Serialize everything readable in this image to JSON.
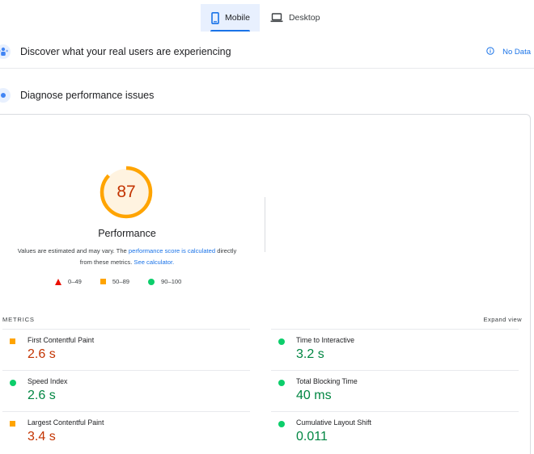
{
  "device_tabs": [
    {
      "label": "Mobile",
      "active": true
    },
    {
      "label": "Desktop",
      "active": false
    }
  ],
  "field_section": {
    "title": "Discover what your real users are experiencing",
    "no_data_label": "No Data"
  },
  "lab_section": {
    "title": "Diagnose performance issues"
  },
  "performance": {
    "score": "87",
    "score_fraction": 0.87,
    "title": "Performance",
    "desc_prefix": "Values are estimated and may vary. The ",
    "desc_link1": "performance score is calculated",
    "desc_middle": " directly from these metrics. ",
    "desc_link2": "See calculator."
  },
  "legend": [
    {
      "shape": "triangle",
      "label": "0–49"
    },
    {
      "shape": "square",
      "label": "50–89"
    },
    {
      "shape": "circle",
      "label": "90–100"
    }
  ],
  "metrics": {
    "heading": "METRICS",
    "expand_label": "Expand view",
    "items": [
      {
        "name": "First Contentful Paint",
        "value": "2.6 s",
        "rating": "average"
      },
      {
        "name": "Time to Interactive",
        "value": "3.2 s",
        "rating": "pass"
      },
      {
        "name": "Speed Index",
        "value": "2.6 s",
        "rating": "pass"
      },
      {
        "name": "Total Blocking Time",
        "value": "40 ms",
        "rating": "pass"
      },
      {
        "name": "Largest Contentful Paint",
        "value": "3.4 s",
        "rating": "average"
      },
      {
        "name": "Cumulative Layout Shift",
        "value": "0.011",
        "rating": "pass"
      }
    ]
  },
  "colors": {
    "accent": "#1a73e8",
    "average": "#ffa400",
    "average_text": "#c33300",
    "pass": "#0cce6b",
    "pass_text": "#018642",
    "fail": "#eb0f00"
  },
  "icons": {
    "mobile_tab": "smartphone-icon",
    "desktop_tab": "laptop-icon",
    "field_section": "users-icon",
    "lab_section": "lab-flask-icon",
    "no_data": "info-icon"
  }
}
